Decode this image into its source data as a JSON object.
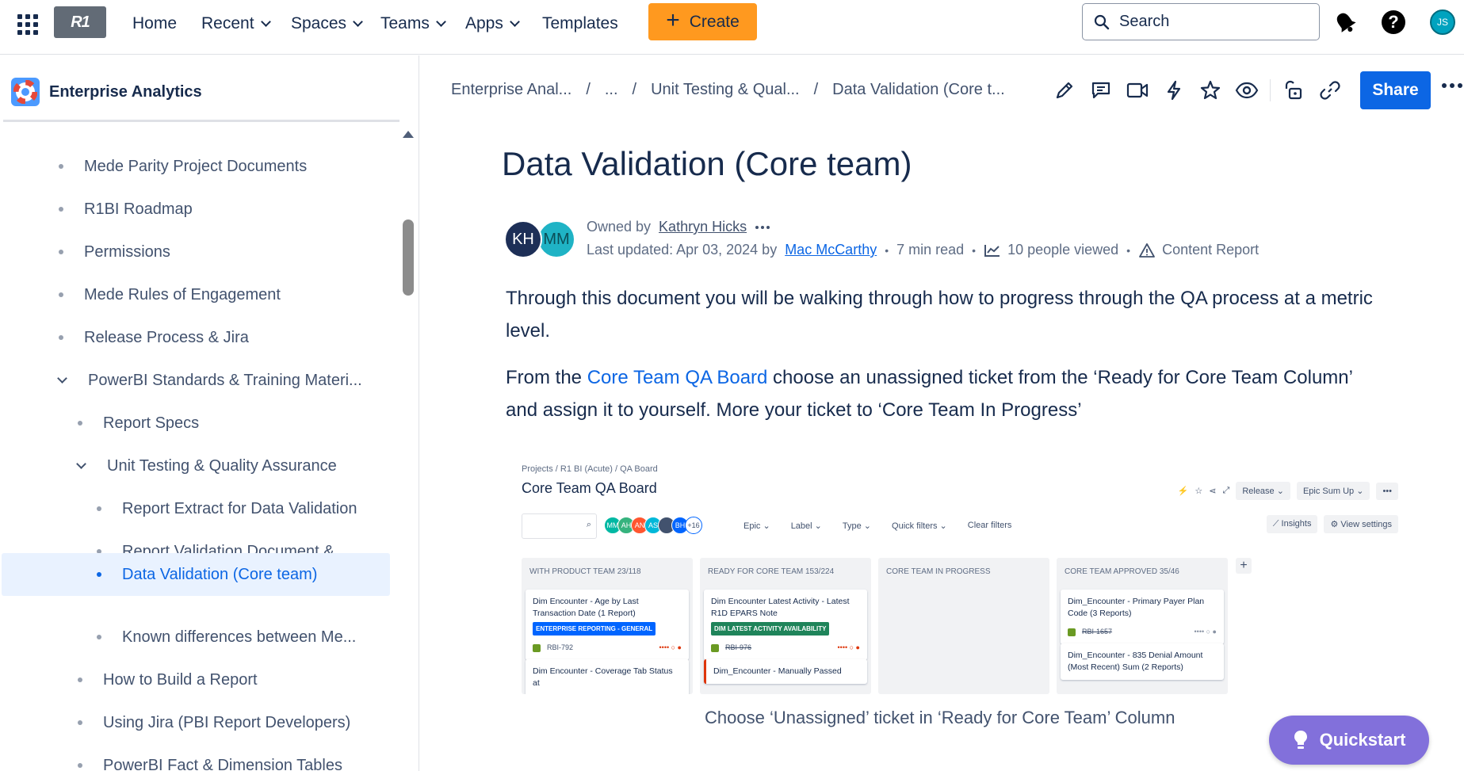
{
  "topnav": {
    "logo_text": "R1",
    "items": [
      {
        "label": "Home"
      },
      {
        "label": "Recent"
      },
      {
        "label": "Spaces"
      },
      {
        "label": "Teams"
      },
      {
        "label": "Apps"
      },
      {
        "label": "Templates"
      }
    ],
    "create_label": "Create",
    "search_placeholder": "Search",
    "user_initials": "JS",
    "accent_color": "#ff991f"
  },
  "sidebar": {
    "space_name": "Enterprise Analytics",
    "items": [
      {
        "label": "Mede Parity Project Documents"
      },
      {
        "label": "R1BI Roadmap"
      },
      {
        "label": "Permissions"
      },
      {
        "label": "Mede Rules of Engagement"
      },
      {
        "label": "Release Process & Jira"
      },
      {
        "label": "PowerBI Standards & Training Materi..."
      },
      {
        "label": "Report Specs"
      },
      {
        "label": "Unit Testing & Quality Assurance"
      },
      {
        "label": "Report Extract for Data Validation"
      },
      {
        "label": "Report Validation Document & ..."
      },
      {
        "label": "Data Validation (Core team)"
      },
      {
        "label": "Known differences between Me..."
      },
      {
        "label": "How to Build a Report"
      },
      {
        "label": "Using Jira (PBI Report Developers)"
      },
      {
        "label": "PowerBI Fact & Dimension Tables"
      }
    ]
  },
  "breadcrumbs": [
    "Enterprise Anal...",
    "...",
    "Unit Testing & Qual...",
    "Data Validation (Core t..."
  ],
  "share_label": "Share",
  "page": {
    "title": "Data Validation (Core team)",
    "owner_prefix": "Owned by",
    "owner": "Kathryn Hicks",
    "updated_prefix": "Last updated: Apr 03, 2024 by",
    "updated_by": "Mac McCarthy",
    "read_time": "7 min read",
    "views": "10 people viewed",
    "content_report": "Content Report",
    "avatar1": "KH",
    "avatar2": "MM",
    "para1": "Through this document you will be walking through how to progress through the QA process at a metric level.",
    "para2_pre": "From the ",
    "para2_link": "Core Team QA Board",
    "para2_post": " choose an unassigned ticket from the ‘Ready for Core Team Column’ and assign it to yourself. More your ticket to ‘Core Team In Progress’",
    "caption": "Choose ‘Unassigned’ ticket in ‘Ready for Core Team’ Column"
  },
  "board": {
    "crumbs": "Projects  /  R1 BI (Acute)  /  QA Board",
    "title": "Core Team QA Board",
    "release": "Release",
    "epic_sum": "Epic Sum Up",
    "avatars": [
      "MM",
      "AH",
      "AN",
      "AS",
      "",
      "BH",
      "+16"
    ],
    "filters": [
      "Epic",
      "Label",
      "Type",
      "Quick filters",
      "Clear filters"
    ],
    "insights": "Insights",
    "view_settings": "View settings",
    "columns": [
      {
        "header": "WITH PRODUCT TEAM 23/118"
      },
      {
        "header": "READY FOR CORE TEAM 153/224"
      },
      {
        "header": "CORE TEAM IN PROGRESS"
      },
      {
        "header": "CORE TEAM APPROVED 35/46"
      }
    ],
    "cards": {
      "c1_title": "Dim Encounter - Age by Last Transaction Date (1 Report)",
      "c1_tag": "ENTERPRISE REPORTING - GENERAL",
      "c1_key": "RBI-792",
      "c1b_title": "Dim Encounter - Coverage Tab Status at",
      "c2_title": "Dim Encounter Latest Activity - Latest R1D EPARS Note",
      "c2_tag": "DIM LATEST ACTIVITY AVAILABILITY",
      "c2_key": "RBI-976",
      "c2b_title": "Dim_Encounter - Manually Passed",
      "c4_title": "Dim_Encounter - Primary Payer Plan Code (3 Reports)",
      "c4_key": "RBI-1657",
      "c4b_title": "Dim_Encounter - 835 Denial Amount (Most Recent) Sum (2 Reports)"
    }
  },
  "quickstart_label": "Quickstart",
  "colors": {
    "primary": "#0c66e4",
    "quickstart": "#8270db"
  }
}
